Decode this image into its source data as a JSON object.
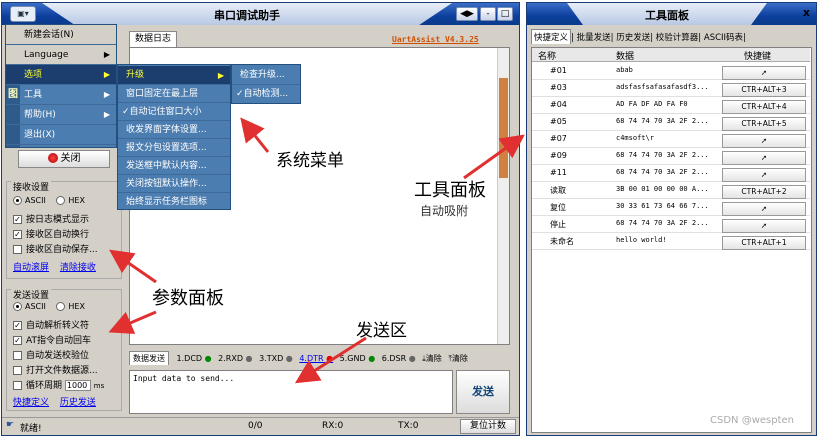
{
  "main_window": {
    "title": "串口调试助手",
    "window_controls": [
      "◀▶",
      "-",
      "□",
      "x"
    ],
    "data_log_tab": "数据日志",
    "brand": "UartAssist V4.3.25"
  },
  "app_menu": {
    "items": [
      {
        "label": "新建会话(N)"
      },
      {
        "label": "Language"
      },
      {
        "label": "选项"
      },
      {
        "label": "工具"
      },
      {
        "label": "帮助(H)"
      },
      {
        "label": "退出(X)"
      }
    ]
  },
  "options_menu": {
    "items": [
      {
        "label": "升级"
      },
      {
        "label": "窗口固定在最上层"
      },
      {
        "label": "✓自动记住窗口大小"
      },
      {
        "label": "收发界面字体设置..."
      },
      {
        "label": "报文分包设置选项..."
      },
      {
        "label": "发送框中默认内容..."
      },
      {
        "label": "关闭按钮默认操作..."
      },
      {
        "label": "始终显示任务栏图标"
      }
    ]
  },
  "upgrade_menu": {
    "items": [
      {
        "label": "检查升级..."
      },
      {
        "label": "✓自动检测..."
      }
    ]
  },
  "left_panel": {
    "close_button": "关闭",
    "receive_group": "接收设置",
    "ascii": "ASCII",
    "hex": "HEX",
    "recv_opts": [
      "按日志模式显示",
      "接收区自动换行",
      "接收区自动保存..."
    ],
    "auto_scroll": "自动滚屏",
    "clear_recv": "清除接收",
    "send_group": "发送设置",
    "send_opts": [
      "自动解析转义符",
      "AT指令自动回车",
      "自动发送校验位",
      "打开文件数据源...",
      "循环周期"
    ],
    "cycle_value": "1000",
    "cycle_unit": "ms",
    "quick_def": "快捷定义",
    "history_send": "历史发送"
  },
  "signal_bar": {
    "send_tab": "数据发送",
    "signals": [
      "1.DCD",
      "2.RXD",
      "3.TXD",
      "4.DTR",
      "5.GND",
      "6.DSR"
    ],
    "clear1": "清除",
    "clear2": "清除"
  },
  "send_area": {
    "placeholder": "Input data to send...",
    "send_button": "发送"
  },
  "status_bar": {
    "ready": "就绪!",
    "count": "0/0",
    "rx": "RX:0",
    "tx": "TX:0",
    "reset": "复位计数"
  },
  "tool_panel": {
    "title": "工具面板",
    "close": "x",
    "tabs": [
      "快捷定义",
      "批量发送",
      "历史发送",
      "校验计算器",
      "ASCII码表"
    ],
    "columns": [
      "名称",
      "数据",
      "快捷键"
    ],
    "rows": [
      {
        "name": "#01",
        "data": "abab",
        "hotkey": "➚"
      },
      {
        "name": "#03",
        "data": "adsfasfsafasafasdf3...",
        "hotkey": "CTR+ALT+3"
      },
      {
        "name": "#04",
        "data": "AD FA DF AD FA F0",
        "hotkey": "CTR+ALT+4"
      },
      {
        "name": "#05",
        "data": "68 74 74 70 3A 2F 2...",
        "hotkey": "CTR+ALT+5"
      },
      {
        "name": "#07",
        "data": "c4msoft\\r",
        "hotkey": "➚"
      },
      {
        "name": "#09",
        "data": "68 74 74 70 3A 2F 2...",
        "hotkey": "➚"
      },
      {
        "name": "#11",
        "data": "68 74 74 70 3A 2F 2...",
        "hotkey": "➚"
      },
      {
        "name": "读取",
        "data": "3B 00 01 00 00 00 A...",
        "hotkey": "CTR+ALT+2"
      },
      {
        "name": "复位",
        "data": "30 33 61 73 64 66 7...",
        "hotkey": "➚"
      },
      {
        "name": "停止",
        "data": "68 74 74 70 3A 2F 2...",
        "hotkey": "➚"
      },
      {
        "name": "未命名",
        "data": "hello world!",
        "hotkey": "CTR+ALT+1"
      }
    ]
  },
  "annotations": {
    "system_menu": "系统菜单",
    "tool_panel": "工具面板",
    "auto_dock": "自动吸附",
    "param_panel": "参数面板",
    "send_area": "发送区"
  },
  "watermark": "CSDN @wespten",
  "colors": {
    "titlebar": "#0b3f9c",
    "menu": "#4c7db0",
    "arrow": "#e03030",
    "brand": "#d05000"
  }
}
